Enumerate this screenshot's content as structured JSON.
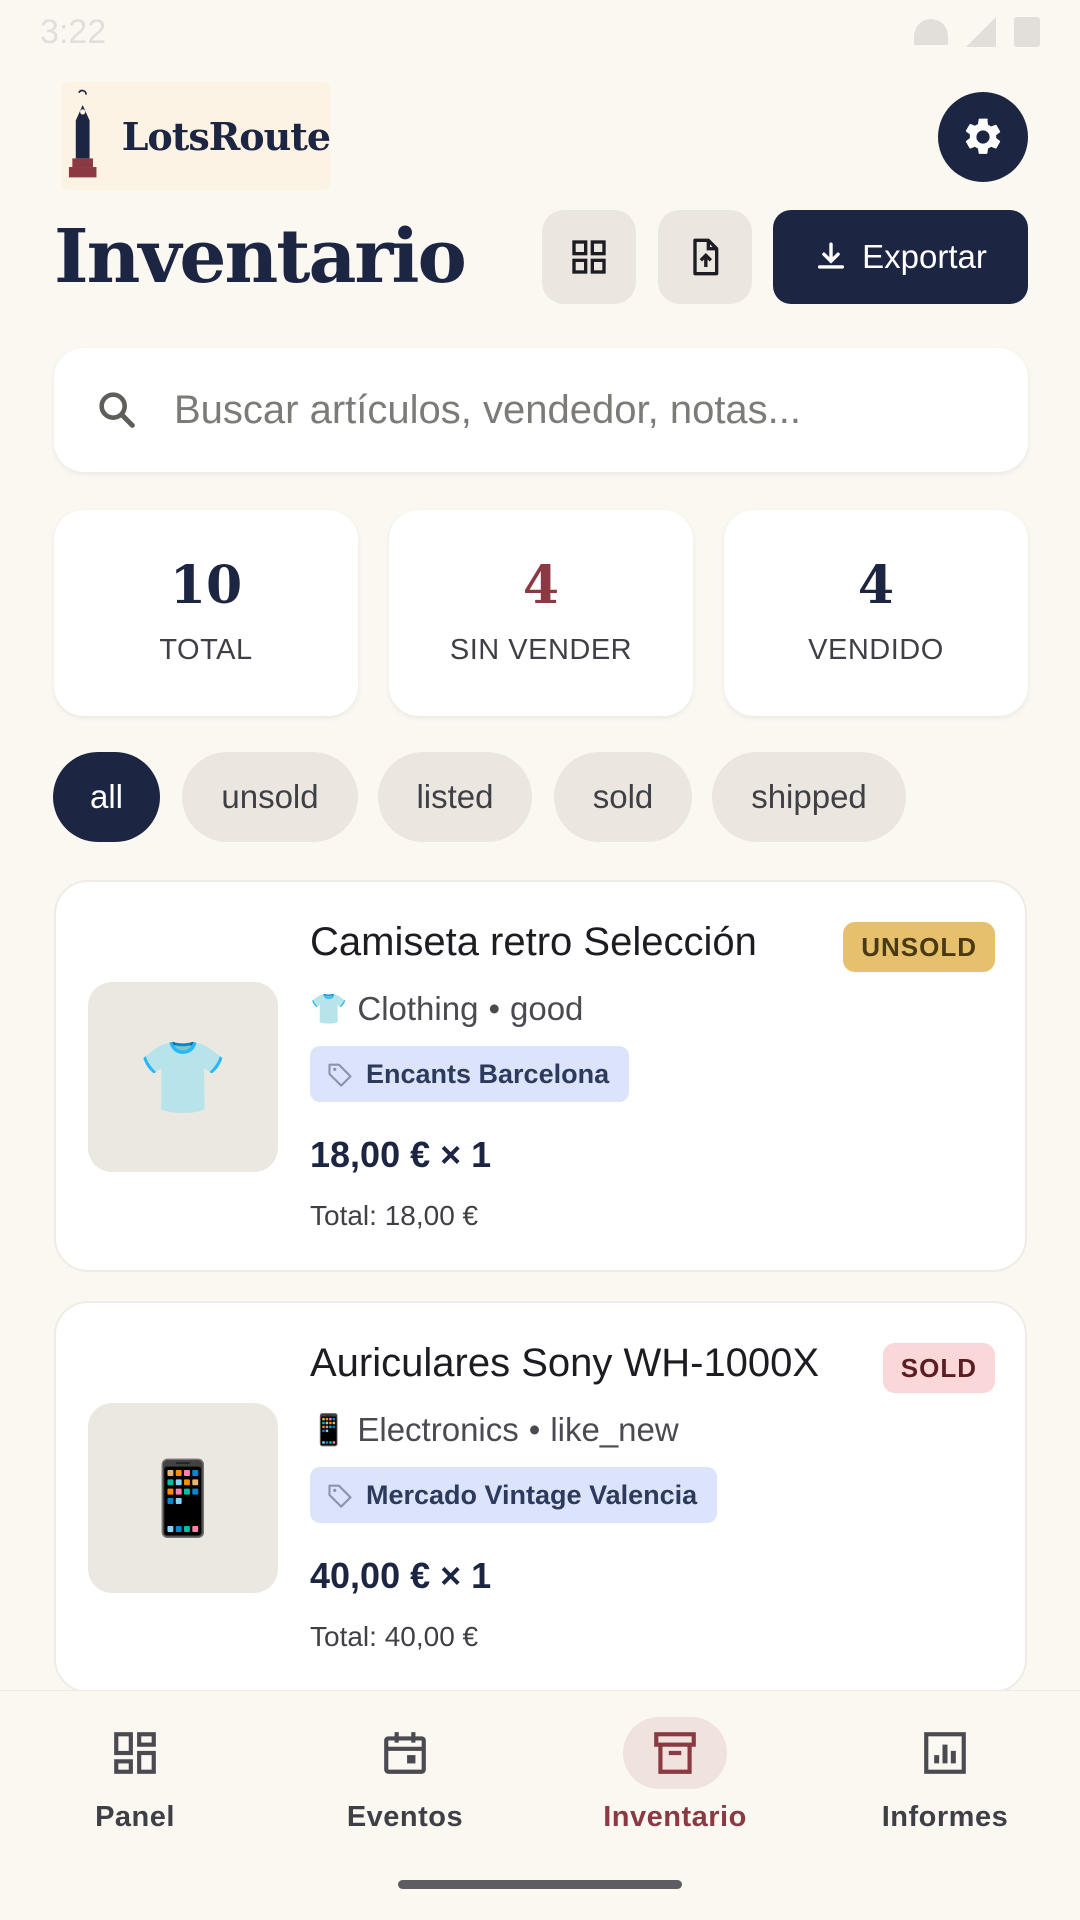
{
  "status_bar": {
    "time": "3:22"
  },
  "app": {
    "logo_text": "LotsRoute"
  },
  "header": {
    "title": "Inventario",
    "export_label": "Exportar"
  },
  "search": {
    "placeholder": "Buscar artículos, vendedor, notas..."
  },
  "stats": [
    {
      "value": "10",
      "label": "TOTAL"
    },
    {
      "value": "4",
      "label": "SIN VENDER"
    },
    {
      "value": "4",
      "label": "VENDIDO"
    }
  ],
  "filters": {
    "selected": "all",
    "chips": [
      "all",
      "unsold",
      "listed",
      "sold",
      "shipped"
    ]
  },
  "items": [
    {
      "name": "Camiseta retro Selección",
      "status": "UNSOLD",
      "category_icon": "👕",
      "category": "Clothing",
      "condition": "good",
      "event": "Encants Barcelona",
      "price_line": "18,00 € × 1",
      "total_line": "Total: 18,00 €",
      "status_color": "#e7c06e"
    },
    {
      "name": "Auriculares Sony WH-1000X",
      "status": "SOLD",
      "category_icon": "📱",
      "category": "Electronics",
      "condition": "like_new",
      "event": "Mercado Vintage Valencia",
      "price_line": "40,00 € × 1",
      "total_line": "Total: 40,00 €",
      "status_color": "#fad7d9"
    }
  ],
  "bottom_nav": [
    {
      "label": "Panel",
      "icon": "dashboard-icon"
    },
    {
      "label": "Eventos",
      "icon": "calendar-icon"
    },
    {
      "label": "Inventario",
      "icon": "archive-box-icon",
      "active": true
    },
    {
      "label": "Informes",
      "icon": "chart-icon"
    }
  ],
  "colors": {
    "primary": "#1c2541",
    "accent": "#8b3a44",
    "background": "#fbf8f2"
  }
}
